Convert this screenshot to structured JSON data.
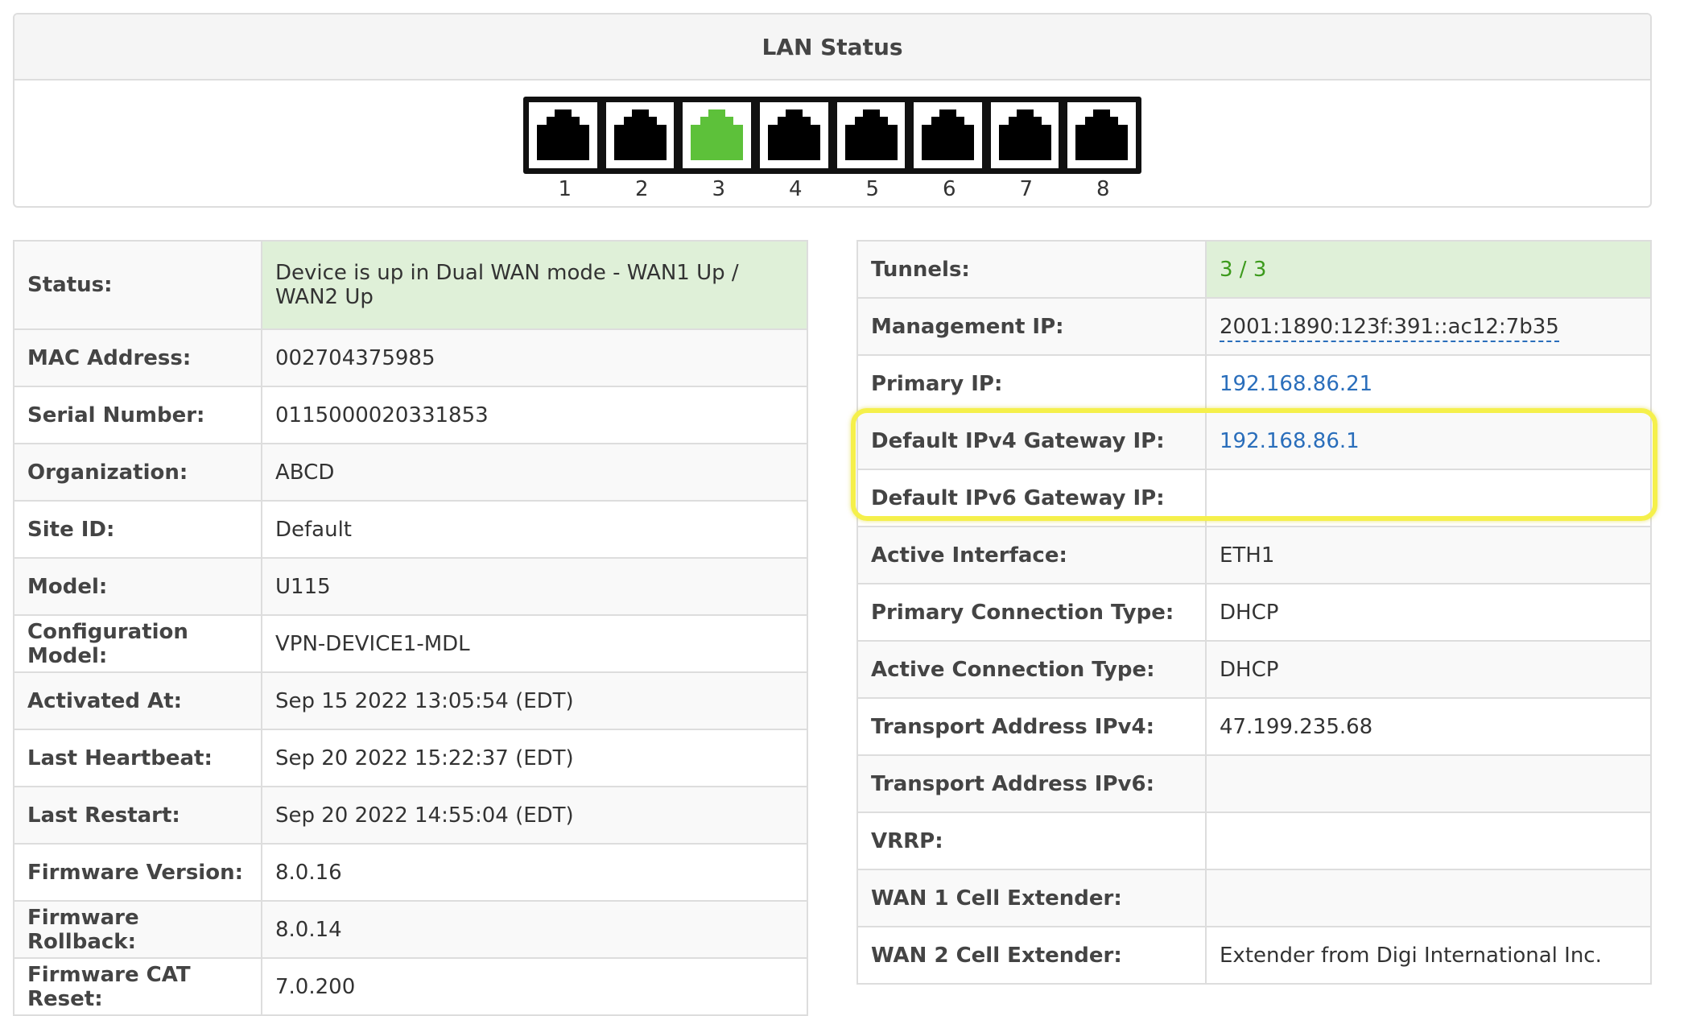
{
  "lan_status": {
    "title": "LAN Status",
    "ports": [
      {
        "label": "1",
        "active": false
      },
      {
        "label": "2",
        "active": false
      },
      {
        "label": "3",
        "active": true
      },
      {
        "label": "4",
        "active": false
      },
      {
        "label": "5",
        "active": false
      },
      {
        "label": "6",
        "active": false
      },
      {
        "label": "7",
        "active": false
      },
      {
        "label": "8",
        "active": false
      }
    ],
    "active_color": "#5dc13a",
    "inactive_color": "#000000"
  },
  "device_info": [
    {
      "label": "Status:",
      "value": "Device is up in Dual WAN mode - WAN1 Up / WAN2 Up"
    },
    {
      "label": "MAC Address:",
      "value": "002704375985"
    },
    {
      "label": "Serial Number:",
      "value": "0115000020331853"
    },
    {
      "label": "Organization:",
      "value": "ABCD"
    },
    {
      "label": "Site ID:",
      "value": "Default"
    },
    {
      "label": "Model:",
      "value": "U115"
    },
    {
      "label": "Configuration Model:",
      "value": "VPN-DEVICE1-MDL"
    },
    {
      "label": "Activated At:",
      "value": "Sep 15 2022 13:05:54 (EDT)"
    },
    {
      "label": "Last Heartbeat:",
      "value": "Sep 20 2022 15:22:37 (EDT)"
    },
    {
      "label": "Last Restart:",
      "value": "Sep 20 2022 14:55:04 (EDT)"
    },
    {
      "label": "Firmware Version:",
      "value": "8.0.16"
    },
    {
      "label": "Firmware Rollback:",
      "value": "8.0.14"
    },
    {
      "label": "Firmware CAT Reset:",
      "value": "7.0.200"
    }
  ],
  "network_info": [
    {
      "label": "Tunnels:",
      "value": "3 / 3"
    },
    {
      "label": "Management IP:",
      "value": "2001:1890:123f:391::ac12:7b35"
    },
    {
      "label": "Primary IP:",
      "value": "192.168.86.21"
    },
    {
      "label": "Default IPv4 Gateway IP:",
      "value": "192.168.86.1"
    },
    {
      "label": "Default IPv6 Gateway IP:",
      "value": ""
    },
    {
      "label": "Active Interface:",
      "value": "ETH1"
    },
    {
      "label": "Primary Connection Type:",
      "value": "DHCP"
    },
    {
      "label": "Active Connection Type:",
      "value": "DHCP"
    },
    {
      "label": "Transport Address IPv4:",
      "value": "47.199.235.68"
    },
    {
      "label": "Transport Address IPv6:",
      "value": ""
    },
    {
      "label": "VRRP:",
      "value": ""
    },
    {
      "label": "WAN 1 Cell Extender:",
      "value": ""
    },
    {
      "label": "WAN 2 Cell Extender:",
      "value": "Extender from Digi International Inc."
    }
  ],
  "colors": {
    "status_success_bg": "#dff0d8",
    "tunnels_text": "#3c9a1c",
    "link_text": "#2a6ebb",
    "highlight": "#f5f04b"
  }
}
